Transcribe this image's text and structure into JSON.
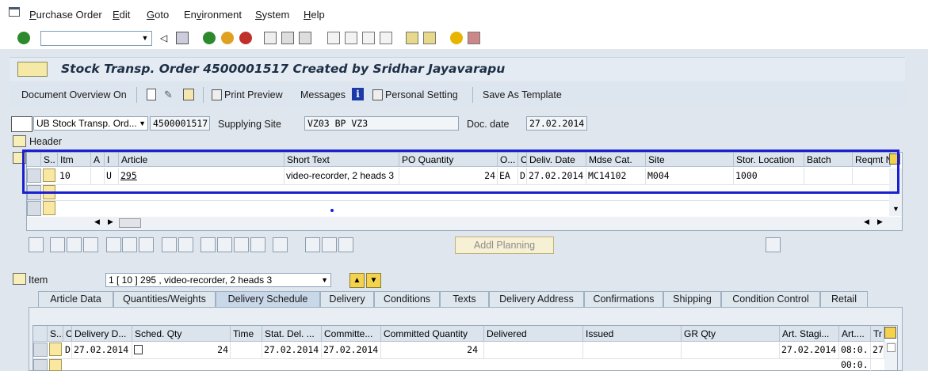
{
  "menu": {
    "items": [
      "Purchase Order",
      "Edit",
      "Goto",
      "Environment",
      "System",
      "Help"
    ],
    "underline": [
      "P",
      "E",
      "G",
      "v",
      "S",
      "H"
    ]
  },
  "title": "Stock Transp. Order 4500001517 Created by Sridhar Jayavarapu",
  "app_toolbar": {
    "doc_overview": "Document Overview On",
    "print_preview": "Print Preview",
    "messages": "Messages",
    "personal_setting": "Personal Setting",
    "save_template": "Save As Template"
  },
  "header_row": {
    "doc_type": "UB Stock Transp. Ord...",
    "po_number": "4500001517",
    "supplying_site_label": "Supplying Site",
    "supplying_site": "VZ03 BP VZ3",
    "doc_date_label": "Doc. date",
    "doc_date": "27.02.2014",
    "header_label": "Header"
  },
  "items": {
    "columns": [
      "S..",
      "Itm",
      "A",
      "I",
      "Article",
      "Short Text",
      "PO Quantity",
      "O...",
      "C",
      "Deliv. Date",
      "Mdse Cat.",
      "Site",
      "Stor. Location",
      "Batch",
      "Reqmt N"
    ],
    "row": {
      "itm": "10",
      "i": "U",
      "article": "295",
      "short_text": "video-recorder, 2 heads 3",
      "po_qty": "24",
      "uom": "EA",
      "c": "D",
      "deliv_date": "27.02.2014",
      "mdse_cat": "MC14102",
      "site": "M004",
      "stor_loc": "1000"
    }
  },
  "addl_planning": "Addl Planning",
  "item_section": {
    "label": "Item",
    "selected": "1 [ 10 ] 295 , video-recorder, 2 heads 3"
  },
  "tabs": [
    "Article Data",
    "Quantities/Weights",
    "Delivery Schedule",
    "Delivery",
    "Conditions",
    "Texts",
    "Delivery Address",
    "Confirmations",
    "Shipping",
    "Condition Control",
    "Retail"
  ],
  "active_tab": "Delivery Schedule",
  "schedule": {
    "columns": [
      "S...",
      "C",
      "Delivery D...",
      "Sched. Qty",
      "Time",
      "Stat. Del. ...",
      "Committe...",
      "Committed Quantity",
      "Delivered",
      "Issued",
      "GR Qty",
      "Art. Stagi...",
      "Art....",
      "Tr"
    ],
    "row": {
      "c": "D",
      "delivery_date": "27.02.2014",
      "sched_qty": "24",
      "stat_del": "27.02.2014",
      "committed": "27.02.2014",
      "committed_qty": "24",
      "art_staging": "27.02.2014",
      "art_time": "08:0...",
      "tr": "27",
      "art_time2": "00:0..."
    }
  },
  "colors": {
    "highlight": "#1a1fd0",
    "title_text": "#1d2f45",
    "input_yellow": "#f9e7a2"
  }
}
